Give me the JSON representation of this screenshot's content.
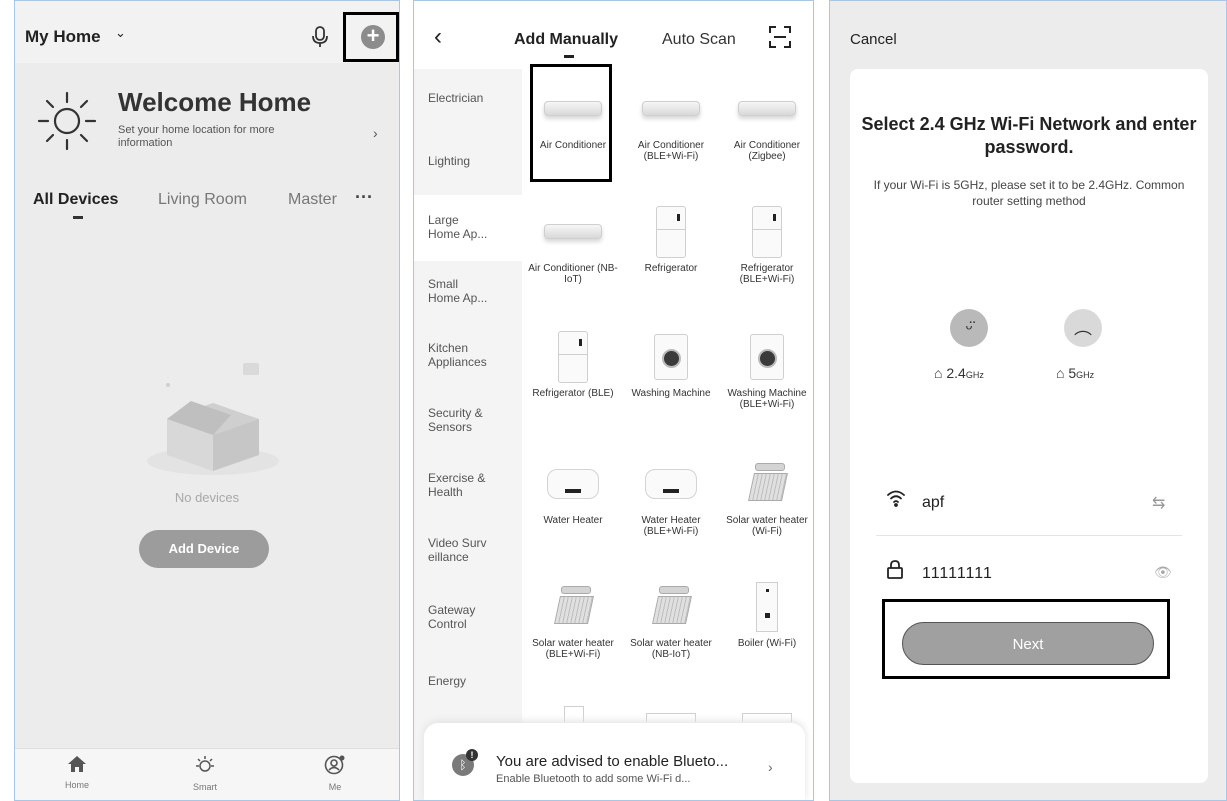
{
  "panel_home": {
    "home_name": "My Home",
    "welcome_title": "Welcome Home",
    "welcome_sub": "Set your home location for more information",
    "tabs": [
      "All Devices",
      "Living Room",
      "Master"
    ],
    "more": "···",
    "empty_text": "No devices",
    "add_device": "Add Device",
    "bottom_tabs": [
      "Home",
      "Smart",
      "Me"
    ]
  },
  "panel_add": {
    "tab_manual": "Add Manually",
    "tab_scan": "Auto Scan",
    "categories": [
      "Electrician",
      "Lighting",
      "Large Home Ap...",
      "Small Home Ap...",
      "Kitchen Appliances",
      "Security & Sensors",
      "Exercise & Health",
      "Video Surv eillance",
      "Gateway Control",
      "Energy"
    ],
    "selected_category": "Large Home Ap...",
    "devices": [
      {
        "name": "Air Conditioner",
        "icon": "air-conditioner-icon"
      },
      {
        "name": "Air Conditioner (BLE+Wi-Fi)",
        "icon": "air-conditioner-icon"
      },
      {
        "name": "Air Conditioner (Zigbee)",
        "icon": "air-conditioner-icon"
      },
      {
        "name": "Air Conditioner (NB-IoT)",
        "icon": "air-conditioner-icon"
      },
      {
        "name": "Refrigerator",
        "icon": "refrigerator-icon"
      },
      {
        "name": "Refrigerator (BLE+Wi-Fi)",
        "icon": "refrigerator-icon"
      },
      {
        "name": "Refrigerator (BLE)",
        "icon": "refrigerator-icon"
      },
      {
        "name": "Washing Machine",
        "icon": "washing-machine-icon"
      },
      {
        "name": "Washing Machine (BLE+Wi-Fi)",
        "icon": "washing-machine-icon"
      },
      {
        "name": "Water Heater",
        "icon": "water-heater-icon"
      },
      {
        "name": "Water Heater (BLE+Wi-Fi)",
        "icon": "water-heater-icon"
      },
      {
        "name": "Solar water heater (Wi-Fi)",
        "icon": "solar-water-heater-icon"
      },
      {
        "name": "Solar water heater (BLE+Wi-Fi)",
        "icon": "solar-water-heater-icon"
      },
      {
        "name": "Solar water heater (NB-IoT)",
        "icon": "solar-water-heater-icon"
      },
      {
        "name": "Boiler (Wi-Fi)",
        "icon": "boiler-icon"
      }
    ],
    "banner_title": "You are advised to enable Blueto...",
    "banner_sub": "Enable Bluetooth to add some Wi-Fi d...",
    "banner_badge": "!"
  },
  "panel_wifi": {
    "cancel": "Cancel",
    "title": "Select 2.4 GHz Wi-Fi Network and enter password.",
    "desc": "If your Wi-Fi is 5GHz, please set it to be 2.4GHz. Common router setting method",
    "band_good_value": "2.4",
    "band_good_unit": "GHz",
    "band_bad_value": "5",
    "band_bad_unit": "GHz",
    "ssid": "apf",
    "password": "11111111",
    "next": "Next"
  },
  "colors": {
    "highlight_border": "#000000",
    "panel_border": "#a9c6e4",
    "button_gray": "#9c9c9c"
  }
}
